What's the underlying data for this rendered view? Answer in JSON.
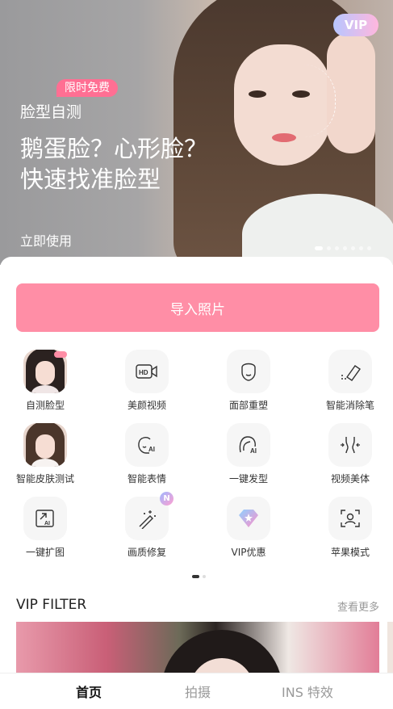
{
  "banner": {
    "vip": "VIP",
    "free_tag": "限时免费",
    "subtitle": "脸型自测",
    "title_line1": "鹅蛋脸？心形脸？",
    "title_line2": "快速找准脸型",
    "cta": "立即使用",
    "page_count": 7,
    "current_page": 1
  },
  "import_button": "导入照片",
  "tools": [
    {
      "label": "自测脸型",
      "icon": "face-photo"
    },
    {
      "label": "美颜视频",
      "icon": "hd-video-icon"
    },
    {
      "label": "面部重塑",
      "icon": "face-outline-icon"
    },
    {
      "label": "智能消除笔",
      "icon": "eraser-icon"
    },
    {
      "label": "智能皮肤测试",
      "icon": "face-photo"
    },
    {
      "label": "智能表情",
      "icon": "ai-face-icon"
    },
    {
      "label": "一键发型",
      "icon": "ai-hair-icon"
    },
    {
      "label": "视频美体",
      "icon": "body-slim-icon"
    },
    {
      "label": "一键扩图",
      "icon": "expand-ai-icon"
    },
    {
      "label": "画质修复",
      "icon": "magic-wand-icon",
      "badge": "N"
    },
    {
      "label": "VIP优惠",
      "icon": "vip-diamond-icon"
    },
    {
      "label": "苹果模式",
      "icon": "portrait-scan-icon"
    }
  ],
  "section": {
    "title": "VIP FILTER",
    "more": "查看更多"
  },
  "tabs": [
    {
      "label": "首页",
      "active": true
    },
    {
      "label": "拍摄",
      "active": false
    },
    {
      "label": "INS 特效",
      "active": false
    }
  ],
  "colors": {
    "accent": "#ff8ea6",
    "tag": "#ff6f93"
  }
}
